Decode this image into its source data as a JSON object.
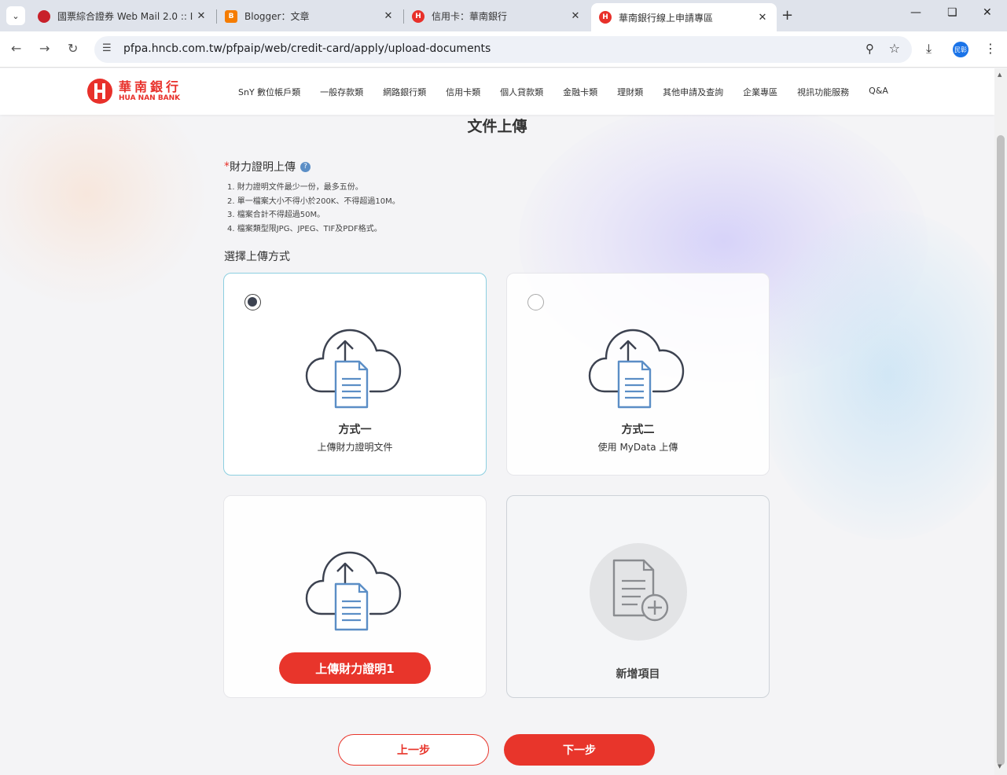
{
  "browser": {
    "tabs": [
      {
        "title": "國票綜合證券 Web Mail 2.0 :: I",
        "favicon_color": "#c8202a"
      },
      {
        "title": "Blogger：文章",
        "favicon_color": "#f57c00"
      },
      {
        "title": "信用卡：華南銀行",
        "favicon_color": "#e8302a"
      },
      {
        "title": "華南銀行線上申請專區",
        "favicon_color": "#e8302a",
        "active": true
      }
    ],
    "url": "pfpa.hncb.com.tw/pfpaip/web/credit-card/apply/upload-documents",
    "profile_label": "民彰"
  },
  "site": {
    "logo_cn": "華南銀行",
    "logo_en": "HUA NAN BANK",
    "nav": [
      "SnY 數位帳戶類",
      "一般存款類",
      "網路銀行類",
      "信用卡類",
      "個人貸款類",
      "金融卡類",
      "理財類",
      "其他申請及查詢",
      "企業專區",
      "視訊功能服務",
      "Q&A"
    ]
  },
  "page": {
    "title": "文件上傳",
    "section_required_mark": "*",
    "section_label": "財力證明上傳",
    "help_icon": "?",
    "rules": [
      "1. 財力證明文件最少一份，最多五份。",
      "2. 單一檔案大小不得小於200K、不得超過10M。",
      "3. 檔案合計不得超過50M。",
      "4. 檔案類型限JPG、JPEG、TIF及PDF格式。"
    ],
    "method_label": "選擇上傳方式",
    "options": [
      {
        "title": "方式一",
        "subtitle": "上傳財力證明文件",
        "selected": true
      },
      {
        "title": "方式二",
        "subtitle": "使用 MyData 上傳",
        "selected": false
      }
    ],
    "upload_button": "上傳財力證明1",
    "add_item_label": "新增項目",
    "prev_button": "上一步",
    "next_button": "下一步"
  },
  "colors": {
    "brand_red": "#e8352b",
    "selected_border": "#8ccfe0",
    "icon_stroke": "#3c4250",
    "doc_blue": "#5b8ec6"
  }
}
